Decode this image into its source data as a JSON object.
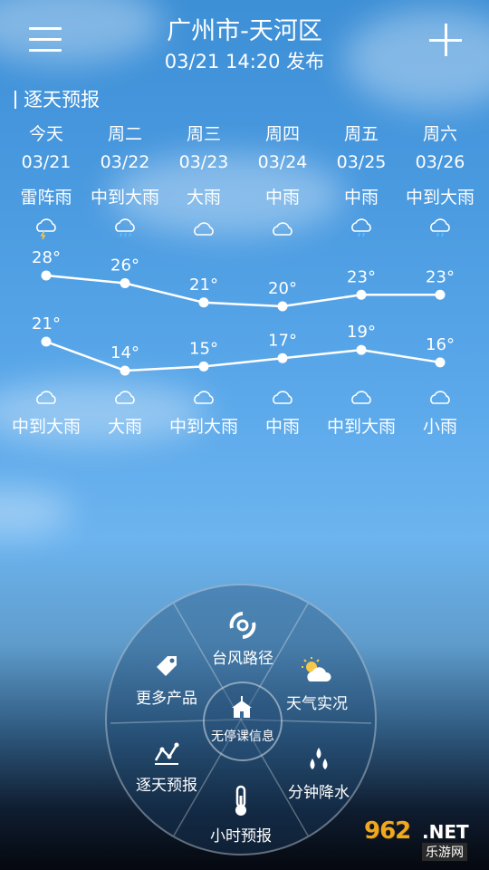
{
  "header": {
    "city": "广州市-天河区",
    "publish_time": "03/21  14:20 发布"
  },
  "section_title": "逐天预报",
  "days": [
    {
      "weekday": "今天",
      "date": "03/21",
      "day_weather": "雷阵雨",
      "day_icon": "thunder-rain-icon",
      "high": "28°",
      "low": "21°",
      "night_icon": "cloud-icon",
      "night_weather": "中到大雨"
    },
    {
      "weekday": "周二",
      "date": "03/22",
      "day_weather": "中到大雨",
      "day_icon": "rain-icon",
      "high": "26°",
      "low": "14°",
      "night_icon": "cloud-icon",
      "night_weather": "大雨"
    },
    {
      "weekday": "周三",
      "date": "03/23",
      "day_weather": "大雨",
      "day_icon": "cloud-icon",
      "high": "21°",
      "low": "15°",
      "night_icon": "cloud-icon",
      "night_weather": "中到大雨"
    },
    {
      "weekday": "周四",
      "date": "03/24",
      "day_weather": "中雨",
      "day_icon": "cloud-icon",
      "high": "20°",
      "low": "17°",
      "night_icon": "cloud-icon",
      "night_weather": "中雨"
    },
    {
      "weekday": "周五",
      "date": "03/25",
      "day_weather": "中雨",
      "day_icon": "rain-icon",
      "high": "23°",
      "low": "19°",
      "night_icon": "cloud-icon",
      "night_weather": "中到大雨"
    },
    {
      "weekday": "周六",
      "date": "03/26",
      "day_weather": "中到大雨",
      "day_icon": "rain-icon",
      "high": "23°",
      "low": "16°",
      "night_icon": "cloud-icon",
      "night_weather": "小雨"
    }
  ],
  "chart_data": {
    "type": "line",
    "categories": [
      "03/21",
      "03/22",
      "03/23",
      "03/24",
      "03/25",
      "03/26"
    ],
    "series": [
      {
        "values": [
          28,
          26,
          21,
          20,
          23,
          23
        ]
      },
      {
        "values": [
          21,
          14,
          15,
          17,
          19,
          16
        ]
      }
    ]
  },
  "dial": {
    "center_label": "无停课信息",
    "items": {
      "typhoon": "台风路径",
      "current_weather": "天气实况",
      "minute_rain": "分钟降水",
      "hourly": "小时预报",
      "daily": "逐天预报",
      "more": "更多产品"
    }
  },
  "watermark": {
    "number": "962",
    "suffix": ".NET",
    "site": "乐游网"
  }
}
